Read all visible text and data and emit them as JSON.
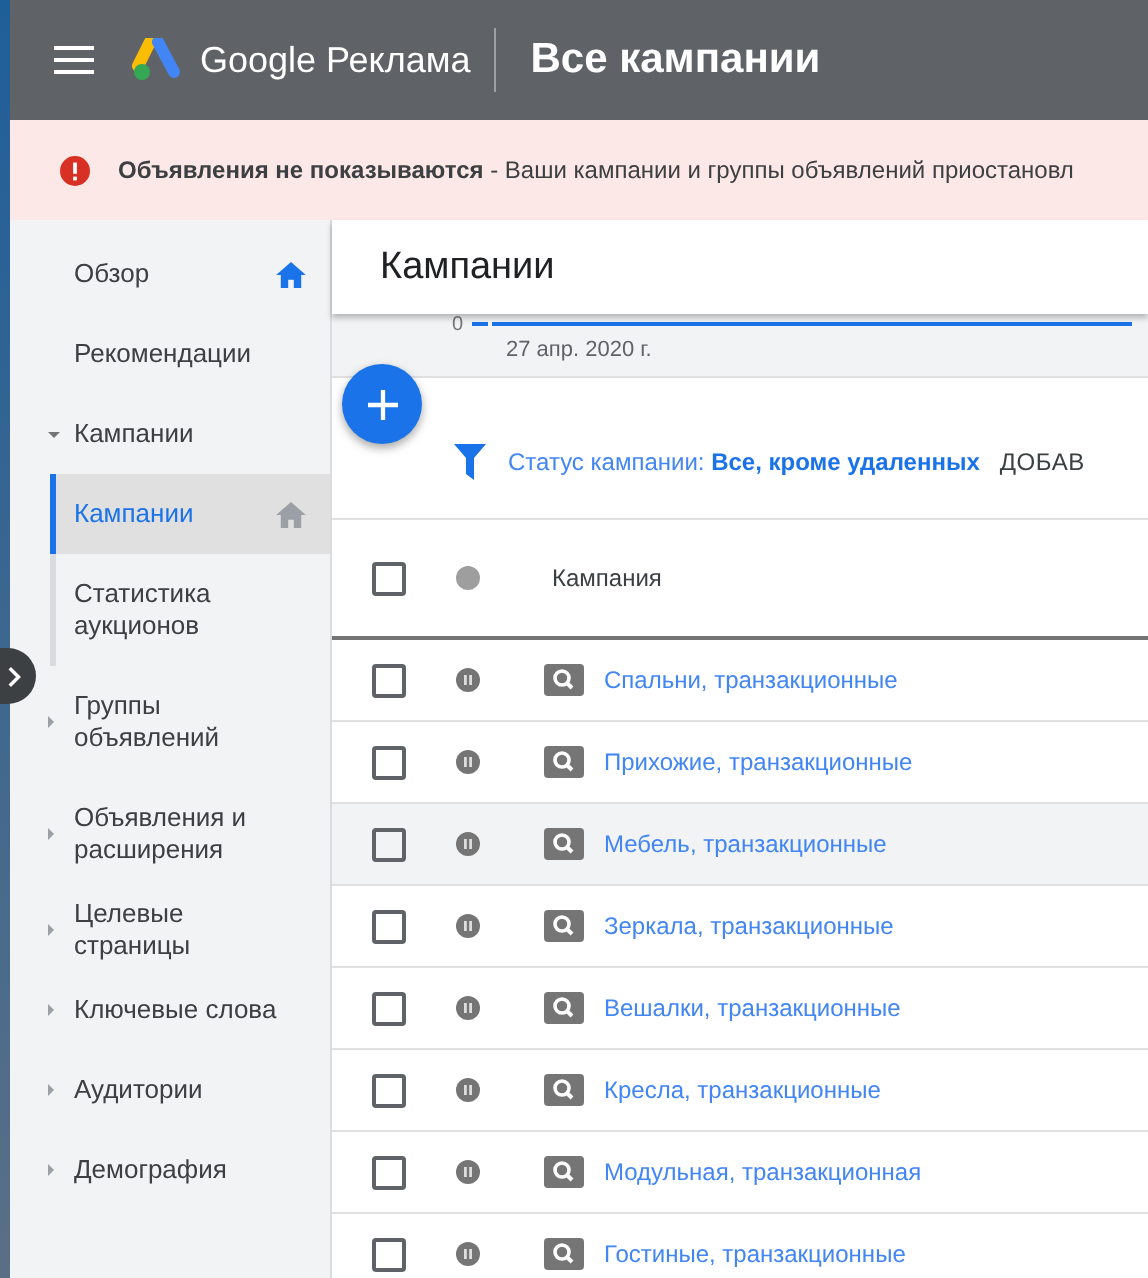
{
  "header": {
    "brand": "Google Реклама",
    "title": "Все кампании"
  },
  "alert": {
    "text": "**Объявления не показываются** - Ваши кампании и группы объявлений приостановл"
  },
  "sidebar": {
    "items": [
      {
        "label": "Обзор",
        "selected": false,
        "pinned": true
      },
      {
        "label": "Рекомендации",
        "selected": false
      },
      {
        "label": "Кампании",
        "selected": false,
        "expanded": true,
        "children": [
          {
            "label": "Кампании",
            "selected": true,
            "pinned": true
          },
          {
            "label": "Статистика аукционов",
            "selected": false
          }
        ]
      },
      {
        "label": "Группы объявлений",
        "selected": false,
        "expanded": false
      },
      {
        "label": "Объявления и расширения",
        "selected": false,
        "expanded": false
      },
      {
        "label": "Целевые страницы",
        "selected": false,
        "expanded": false
      },
      {
        "label": "Ключевые слова",
        "selected": false,
        "expanded": false
      },
      {
        "label": "Аудитории",
        "selected": false,
        "expanded": false
      },
      {
        "label": "Демография",
        "selected": false,
        "expanded": false
      }
    ]
  },
  "page": {
    "title": "Кампании"
  },
  "chart": {
    "y_tick": "0",
    "x_label": "27 апр. 2020 г."
  },
  "filter": {
    "text": "Статус кампании: **Все, кроме удаленных**",
    "add_button": "ДОБАВ"
  },
  "table": {
    "select_all_checked": false,
    "columns": [
      "Кампания"
    ],
    "rows": [
      {
        "checked": false,
        "paused": true,
        "highlighted": false,
        "name": "Спальни, транзакционные"
      },
      {
        "checked": false,
        "paused": true,
        "highlighted": false,
        "name": "Прихожие, транзакционные"
      },
      {
        "checked": false,
        "paused": true,
        "highlighted": true,
        "name": "Мебель, транзакционные"
      },
      {
        "checked": false,
        "paused": true,
        "highlighted": false,
        "name": "Зеркала, транзакционные"
      },
      {
        "checked": false,
        "paused": true,
        "highlighted": false,
        "name": "Вешалки, транзакционные"
      },
      {
        "checked": false,
        "paused": true,
        "highlighted": false,
        "name": "Кресла, транзакционные"
      },
      {
        "checked": false,
        "paused": true,
        "highlighted": false,
        "name": "Модульная, транзакционная"
      },
      {
        "checked": false,
        "paused": true,
        "highlighted": false,
        "name": "Гостиные, транзакционные"
      }
    ]
  }
}
